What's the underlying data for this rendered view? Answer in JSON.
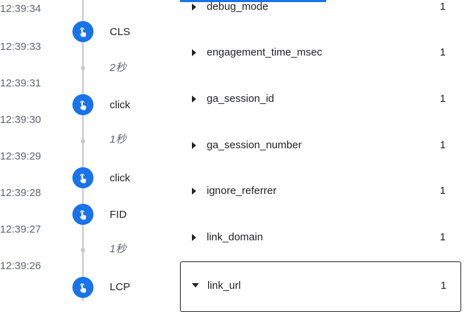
{
  "timeline": {
    "timestamps": [
      "12:39:34",
      "12:39:33",
      "12:39:31",
      "12:39:30",
      "12:39:29",
      "12:39:28",
      "12:39:27",
      "12:39:26"
    ],
    "events": [
      {
        "label": "CLS",
        "icon": "tap-icon"
      },
      {
        "label": "click",
        "icon": "tap-icon"
      },
      {
        "label": "click",
        "icon": "tap-icon"
      },
      {
        "label": "FID",
        "icon": "tap-icon"
      },
      {
        "label": "LCP",
        "icon": "tap-icon"
      }
    ],
    "durations": [
      "2秒",
      "1秒",
      "1秒"
    ],
    "accent_color": "#1a73e8"
  },
  "parameters": [
    {
      "name": "debug_mode",
      "count": "1",
      "expanded": false
    },
    {
      "name": "engagement_time_msec",
      "count": "1",
      "expanded": false
    },
    {
      "name": "ga_session_id",
      "count": "1",
      "expanded": false
    },
    {
      "name": "ga_session_number",
      "count": "1",
      "expanded": false
    },
    {
      "name": "ignore_referrer",
      "count": "1",
      "expanded": false
    },
    {
      "name": "link_domain",
      "count": "1",
      "expanded": false
    },
    {
      "name": "link_url",
      "count": "1",
      "expanded": true
    }
  ]
}
